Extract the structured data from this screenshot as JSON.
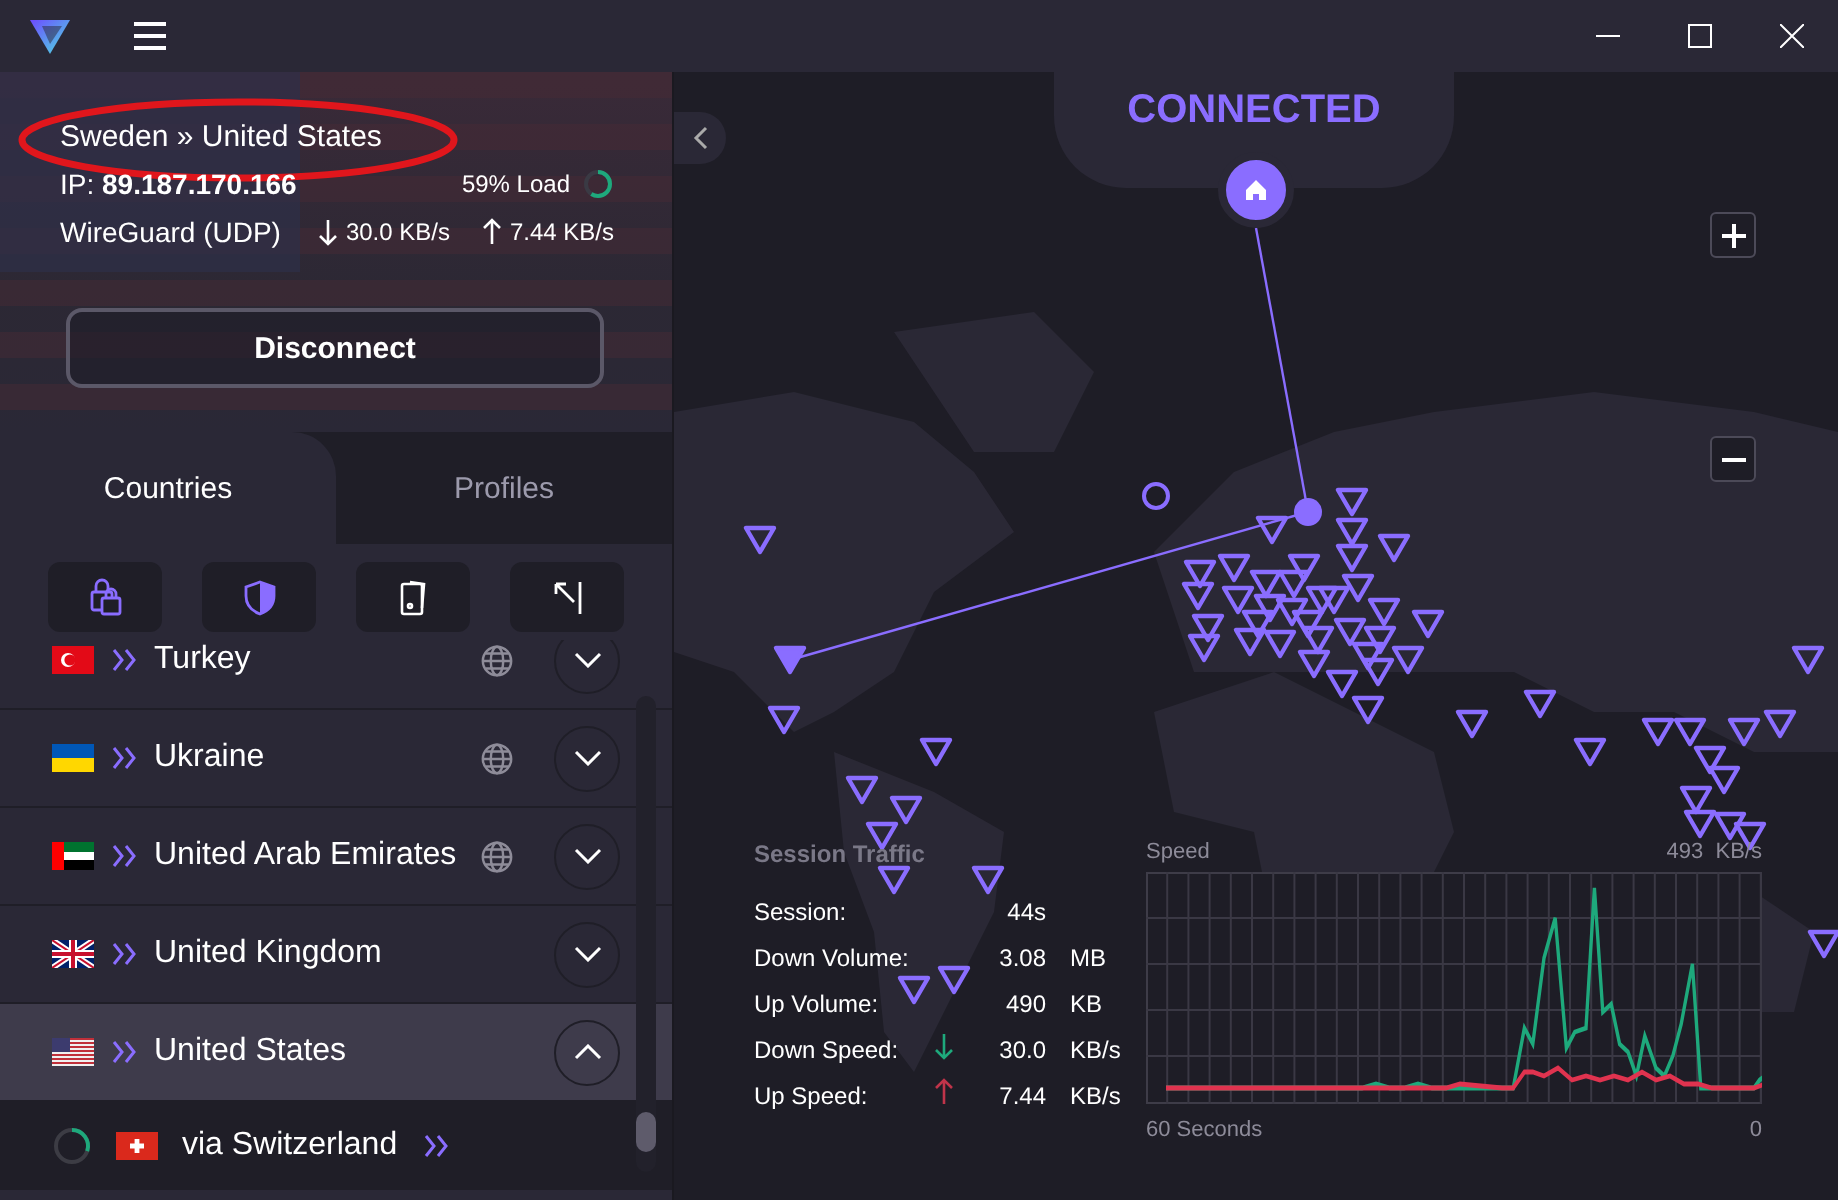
{
  "connection": {
    "route": "Sweden » United States",
    "ip_label": "IP:",
    "ip": "89.187.170.166",
    "load": "59% Load",
    "level": 0.59,
    "protocol": "WireGuard (UDP)",
    "down": "30.0 KB/s",
    "up": "7.44 KB/s"
  },
  "disconnect_button": "Disconnect",
  "tabs": [
    {
      "label": "Countries",
      "selected": true
    },
    {
      "label": "Profiles",
      "selected": false
    }
  ],
  "countries": [
    {
      "name": "Turkey",
      "kind": "tr",
      "globe": true,
      "expanded": false
    },
    {
      "name": "Ukraine",
      "kind": "ua",
      "globe": true,
      "expanded": false
    },
    {
      "name": "United Arab Emirates",
      "kind": "ae",
      "globe": true,
      "expanded": false
    },
    {
      "name": "United Kingdom",
      "kind": "gb",
      "globe": false,
      "expanded": false
    },
    {
      "name": "United States",
      "kind": "us",
      "globe": false,
      "expanded": true
    }
  ],
  "servers": [
    {
      "name": "via Switzerland",
      "kind": "ch"
    }
  ],
  "map": {
    "status": "CONNECTED"
  },
  "session_traffic": {
    "title": "Session Traffic",
    "rows": [
      {
        "label": "Session:",
        "value": "44s"
      },
      {
        "label": "Down Volume:",
        "value": "3.08",
        "unit": "MB"
      },
      {
        "label": "Up Volume:",
        "value": "490",
        "unit": "KB"
      },
      {
        "label": "Down Speed:",
        "value": "30.0",
        "unit": "KB/s",
        "kind": "down"
      },
      {
        "label": "Up Speed:",
        "value": "7.44",
        "unit": "KB/s",
        "kind": "up"
      }
    ]
  },
  "speed_graph": {
    "title": "Speed",
    "max": "493  KB/s",
    "x_start": "60 Seconds",
    "x_end": "0"
  }
}
